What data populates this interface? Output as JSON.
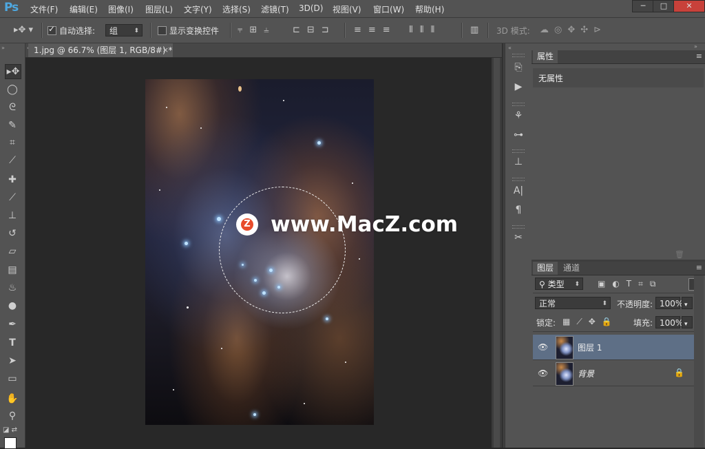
{
  "app": {
    "logo": "Ps"
  },
  "menu": [
    "文件(F)",
    "编辑(E)",
    "图像(I)",
    "图层(L)",
    "文字(Y)",
    "选择(S)",
    "滤镜(T)",
    "3D(D)",
    "视图(V)",
    "窗口(W)",
    "帮助(H)"
  ],
  "window_controls": {
    "minimize": "─",
    "maximize": "□",
    "close": "✕"
  },
  "options_bar": {
    "auto_select_label": "自动选择:",
    "auto_select_checked": true,
    "auto_select_value": "组",
    "transform_label": "显示变换控件",
    "transform_checked": false,
    "mode_3d_label": "3D 模式:"
  },
  "document": {
    "tab_title": "1.jpg @ 66.7% (图层 1, RGB/8#) *",
    "close": "×"
  },
  "watermark": {
    "logo": "Z",
    "text": "www.MacZ.com"
  },
  "properties_panel": {
    "tab": "属性",
    "content": "无属性"
  },
  "layers_panel": {
    "tabs": [
      "图层",
      "通道"
    ],
    "filter_kind": "类型",
    "blend_mode": "正常",
    "opacity_label": "不透明度:",
    "opacity_value": "100%",
    "lock_label": "锁定:",
    "fill_label": "填充:",
    "fill_value": "100%",
    "layers": [
      {
        "name": "图层 1",
        "selected": true,
        "locked": false
      },
      {
        "name": "背景",
        "selected": false,
        "locked": true
      }
    ]
  },
  "icons": {
    "move": "move-tool-icon",
    "eye": "visibility-eye-icon",
    "lock": "lock-icon"
  }
}
